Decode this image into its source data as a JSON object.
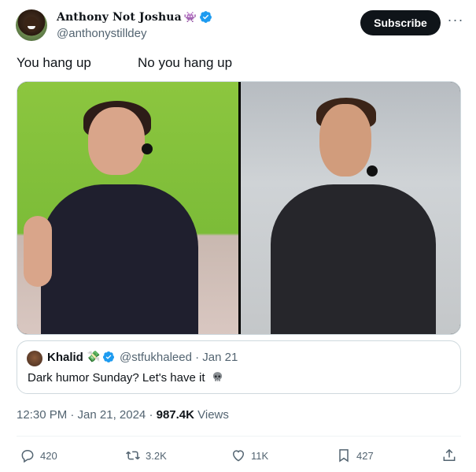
{
  "author": {
    "display_name": "Anthony Not Joshua",
    "name_emoji": "👾",
    "handle": "@anthonystilldey",
    "verified": true
  },
  "subscribe_label": "Subscribe",
  "more_label": "···",
  "caption": {
    "left": "You hang up",
    "right": "No you hang up"
  },
  "quoted_post": {
    "name": "Khalid",
    "name_emoji": "💸",
    "handle_date": "@stfukhaleed · Jan 21",
    "text": "Dark humor Sunday? Let's have it"
  },
  "meta": {
    "time_date": "12:30 PM · Jan 21, 2024 · ",
    "views_count": "987.4K",
    "views_label": " Views"
  },
  "actions": {
    "replies": "420",
    "reposts": "3.2K",
    "likes": "11K",
    "bookmarks": "427"
  },
  "colors": {
    "accent": "#1d9bf0",
    "text": "#0f1419",
    "secondary": "#536471",
    "border": "#cfd9de"
  }
}
